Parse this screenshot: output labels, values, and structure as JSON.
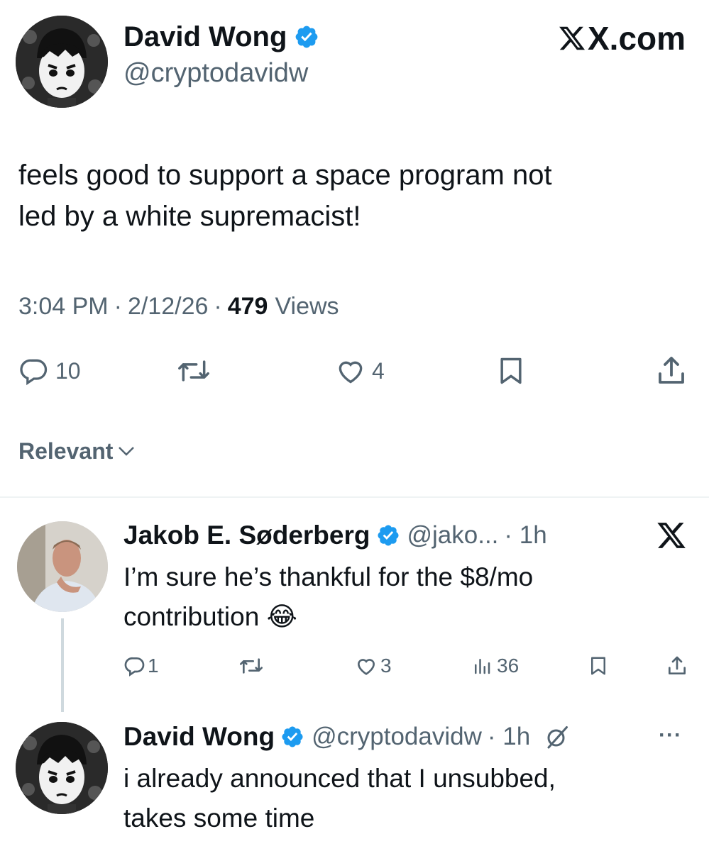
{
  "header": {
    "author_name": "David Wong",
    "author_handle": "@cryptodavidw",
    "site_label": "X.com"
  },
  "tweet": {
    "text_line1": "feels good to support a space program not",
    "text_line2": "led by a white supremacist!",
    "time": "3:04 PM",
    "date": "2/12/26",
    "views_count": "479",
    "views_label": "Views",
    "separator": "·",
    "replies": "10",
    "likes": "4"
  },
  "sort": {
    "label": "Relevant"
  },
  "reply1": {
    "name": "Jakob E. Søderberg",
    "handle": "@jako...",
    "time": "· 1h",
    "text_line1": "I’m sure he’s thankful for the $8/mo",
    "text_line2": "contribution 😂",
    "replies": "1",
    "likes": "3",
    "views": "36"
  },
  "reply2": {
    "name": "David Wong",
    "handle": "@cryptodavidw",
    "time": "· 1h",
    "more": "···",
    "text_line1": "i already announced that I unsubbed,",
    "text_line2": "takes some time"
  },
  "colors": {
    "text": "#0f1419",
    "muted": "#536471",
    "verified": "#1d9bf0",
    "divider": "#eff3f4"
  },
  "icons": [
    "verified-badge-icon",
    "x-logo-icon",
    "reply-icon",
    "repost-icon",
    "like-icon",
    "bookmark-icon",
    "share-icon",
    "chevron-down-icon",
    "views-icon",
    "grok-slash-icon",
    "more-icon"
  ]
}
